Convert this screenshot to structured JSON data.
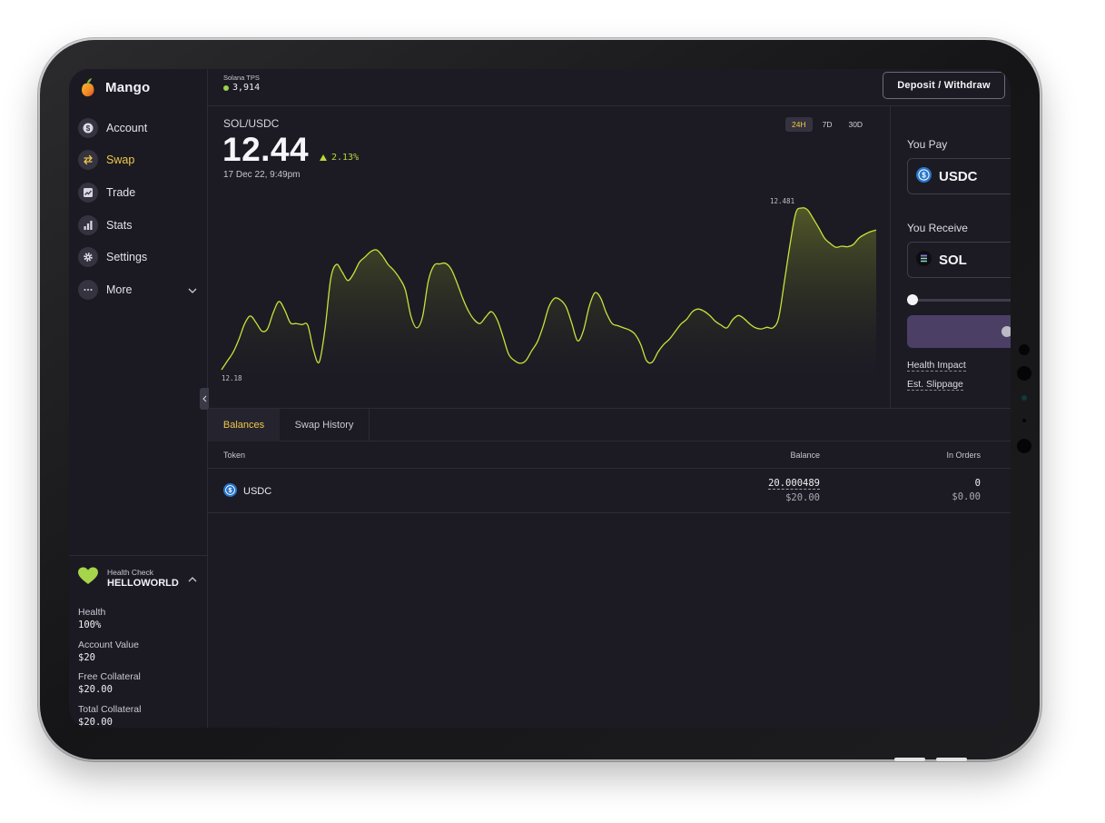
{
  "app": {
    "name": "Mango"
  },
  "sidebar": {
    "items": [
      {
        "label": "Account",
        "icon": "account-dollar-icon"
      },
      {
        "label": "Swap",
        "icon": "swap-arrows-icon",
        "active": true
      },
      {
        "label": "Trade",
        "icon": "trade-chart-icon"
      },
      {
        "label": "Stats",
        "icon": "stats-bars-icon"
      },
      {
        "label": "Settings",
        "icon": "gear-icon"
      },
      {
        "label": "More",
        "icon": "more-dots-icon"
      }
    ],
    "health": {
      "title": "Health Check",
      "account_name": "HELLOWORLD",
      "stats": [
        {
          "label": "Health",
          "value": "100%"
        },
        {
          "label": "Account Value",
          "value": "$20"
        },
        {
          "label": "Free Collateral",
          "value": "$20.00"
        },
        {
          "label": "Total Collateral",
          "value": "$20.00"
        }
      ]
    }
  },
  "topbar": {
    "tps_label": "Solana TPS",
    "tps_value": "3,914",
    "deposit_label": "Deposit / Withdraw"
  },
  "market": {
    "pair": "SOL/USDC",
    "price": "12.44",
    "change": "2.13%",
    "timestamp": "17 Dec 22, 9:49pm",
    "ranges": [
      "24H",
      "7D",
      "30D"
    ],
    "active_range": "24H",
    "high_label": "12.481",
    "low_label": "12.18"
  },
  "chart_data": {
    "type": "area",
    "title": "SOL/USDC",
    "x": [
      0,
      1,
      2,
      3,
      4,
      5,
      6,
      7,
      8,
      9,
      10,
      11,
      12,
      13,
      14,
      15,
      16,
      17,
      18,
      19,
      20,
      21,
      22,
      23,
      24,
      25,
      26,
      27,
      28,
      29,
      30,
      31,
      32,
      33,
      34,
      35,
      36,
      37,
      38,
      39,
      40,
      41,
      42,
      43,
      44,
      45,
      46,
      47,
      48,
      49,
      50,
      51,
      52,
      53,
      54,
      55,
      56,
      57,
      58,
      59,
      60,
      61,
      62,
      63,
      64,
      65,
      66,
      67,
      68,
      69,
      70,
      71,
      72,
      73,
      74,
      75,
      76,
      77,
      78,
      79,
      80,
      81,
      82,
      83,
      84,
      85,
      86,
      87,
      88,
      89,
      90,
      91,
      92,
      93,
      94,
      95,
      96,
      97,
      98,
      99,
      100,
      101,
      102,
      103,
      104,
      105,
      106,
      107,
      108,
      109,
      110,
      111,
      112,
      113,
      114,
      115,
      116,
      117,
      118,
      119,
      120,
      121,
      122,
      123,
      124,
      125,
      126,
      127,
      128,
      129,
      130,
      131,
      132,
      133,
      134,
      135,
      136,
      137,
      138,
      139,
      140,
      141,
      142,
      143
    ],
    "series": [
      {
        "values": [
          12.18,
          12.196,
          12.212,
          12.236,
          12.265,
          12.28,
          12.268,
          12.252,
          12.256,
          12.286,
          12.307,
          12.291,
          12.267,
          12.266,
          12.264,
          12.263,
          12.217,
          12.194,
          12.254,
          12.349,
          12.376,
          12.362,
          12.346,
          12.359,
          12.38,
          12.39,
          12.4,
          12.403,
          12.392,
          12.376,
          12.365,
          12.35,
          12.329,
          12.279,
          12.258,
          12.279,
          12.345,
          12.374,
          12.377,
          12.378,
          12.367,
          12.342,
          12.313,
          12.289,
          12.273,
          12.266,
          12.278,
          12.288,
          12.273,
          12.242,
          12.209,
          12.197,
          12.192,
          12.197,
          12.215,
          12.232,
          12.261,
          12.297,
          12.313,
          12.31,
          12.297,
          12.266,
          12.234,
          12.252,
          12.297,
          12.323,
          12.314,
          12.286,
          12.266,
          12.262,
          12.258,
          12.254,
          12.246,
          12.227,
          12.197,
          12.194,
          12.213,
          12.227,
          12.237,
          12.251,
          12.265,
          12.274,
          12.288,
          12.293,
          12.289,
          12.281,
          12.27,
          12.263,
          12.258,
          12.273,
          12.281,
          12.275,
          12.265,
          12.258,
          12.256,
          12.259,
          12.258,
          12.276,
          12.343,
          12.413,
          12.472,
          12.481,
          12.478,
          12.462,
          12.444,
          12.425,
          12.415,
          12.408,
          12.41,
          12.409,
          12.413,
          12.425,
          12.432,
          12.437,
          12.44
        ],
        "color": "#c9e13a"
      }
    ],
    "ylim": [
      12.14,
      12.5
    ],
    "grid": false,
    "legend": "none"
  },
  "swap": {
    "pay_label": "You Pay",
    "pay_token": "USDC",
    "receive_label": "You Receive",
    "receive_token": "SOL",
    "health_impact": "Health Impact",
    "slippage": "Est. Slippage"
  },
  "balances": {
    "tabs": [
      "Balances",
      "Swap History"
    ],
    "columns": {
      "token": "Token",
      "balance": "Balance",
      "in_orders": "In Orders"
    },
    "rows": [
      {
        "token": "USDC",
        "balance": "20.000489",
        "balance_usd": "$20.00",
        "in_orders": "0",
        "in_orders_usd": "$0.00"
      }
    ]
  },
  "colors": {
    "accent_yellow": "#f0c84a",
    "chart_line": "#c9e13a",
    "health_green": "#9bd34a",
    "swap_button": "#4c3f66",
    "background": "#1c1b24"
  }
}
